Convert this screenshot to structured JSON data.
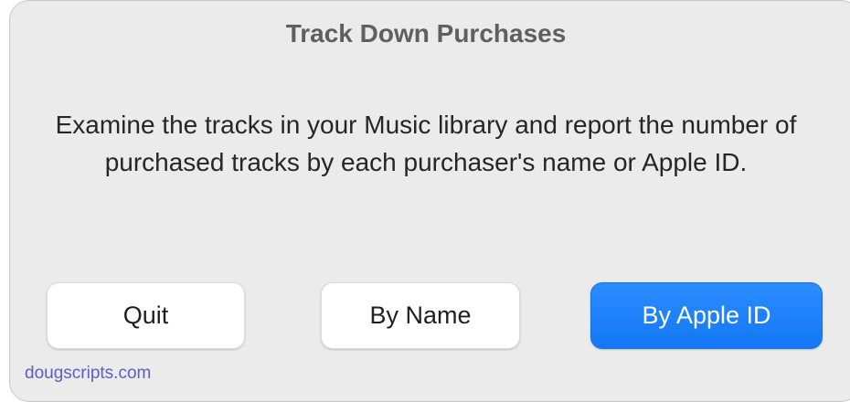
{
  "dialog": {
    "title": "Track Down Purchases",
    "message": "Examine the tracks in your Music library and report the number of purchased tracks by each purchaser's name or Apple ID.",
    "buttons": {
      "quit": "Quit",
      "by_name": "By Name",
      "by_apple_id": "By Apple ID"
    },
    "footer_link": "dougscripts.com"
  },
  "colors": {
    "dialog_background": "#ebebeb",
    "primary_button": "#1a7ff7",
    "link": "#5a5fc8"
  }
}
